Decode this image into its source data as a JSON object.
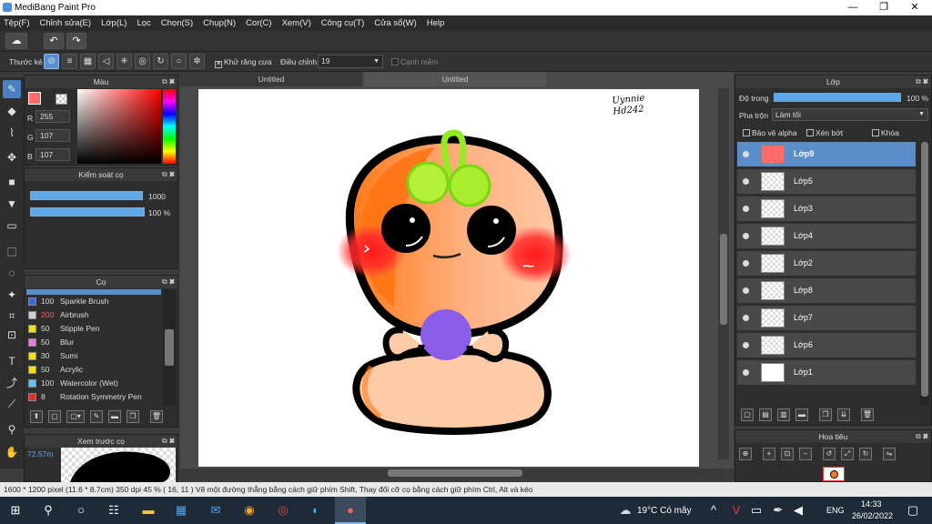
{
  "window": {
    "title": "MediBang Paint Pro",
    "min": "—",
    "max": "❐",
    "close": "✕"
  },
  "menu": [
    "Tệp(F)",
    "Chỉnh sửa(E)",
    "Lớp(L)",
    "Lọc",
    "Chọn(S)",
    "Chụp(N)",
    "Cor(C)",
    "Xem(V)",
    "Công cụ(T)",
    "Cửa sổ(W)",
    "Help"
  ],
  "toolbar2": {
    "ruler_label": "Thước kẻ",
    "antialias_label": "Khử răng cưa",
    "adjust_label": "Điều chỉnh",
    "adjust_value": "19",
    "edge_label": "Cạnh mềm"
  },
  "color_panel": {
    "title": "Màu",
    "r_label": "R",
    "g_label": "G",
    "b_label": "B",
    "r": "255",
    "g": "107",
    "b": "107",
    "current_color": "#ff6b6b"
  },
  "brush_control": {
    "title": "Kiểm soát cọ",
    "size": "1000",
    "opacity": "100 %"
  },
  "brush_panel": {
    "title": "Cọ",
    "items": [
      {
        "size": "100",
        "name": "Sparkle Brush",
        "color": "#3a6ad0"
      },
      {
        "size": "200",
        "name": "Airbrush",
        "color": "#cfcfcf"
      },
      {
        "size": "50",
        "name": "Stipple Pen",
        "color": "#f0e020"
      },
      {
        "size": "50",
        "name": "Blur",
        "color": "#e080e0"
      },
      {
        "size": "30",
        "name": "Sumi",
        "color": "#f0e020"
      },
      {
        "size": "50",
        "name": "Acrylic",
        "color": "#f0e020"
      },
      {
        "size": "100",
        "name": "Watercolor (Wet)",
        "color": "#60c0f0"
      },
      {
        "size": "8",
        "name": "Rotation Symmetry Pen",
        "color": "#e03030"
      }
    ]
  },
  "preview_panel": {
    "title": "Xem trước cọ",
    "zoom": "72.57m"
  },
  "tabs": [
    "Untitled",
    "Untitled"
  ],
  "signature": "Uynnie Hd242",
  "layers_panel": {
    "title": "Lớp",
    "opacity_label": "Độ trong",
    "opacity_value": "100 %",
    "blend_label": "Pha trộn",
    "blend_value": "Làm tối",
    "protect_alpha": "Bảo vệ alpha",
    "clip": "Xén bớt",
    "lock": "Khóa",
    "layers": [
      "Lớp9",
      "Lớp5",
      "Lớp3",
      "Lớp4",
      "Lớp2",
      "Lớp8",
      "Lớp7",
      "Lớp6",
      "Lớp1"
    ]
  },
  "navigator": {
    "title": "Hoa tiêu"
  },
  "status": "1600 * 1200 pixel   (11.6 * 8.7cm)   350 dpi   45 %   ( 16, 11 )   Vẽ một đường thẳng bằng cách giữ phím Shift, Thay đổi cỡ cọ bằng cách giữ phím Ctrl, Alt và kéo",
  "taskbar": {
    "weather": "19°C  Có mây",
    "lang": "ENG",
    "time": "14:33",
    "date": "26/02/2022"
  }
}
